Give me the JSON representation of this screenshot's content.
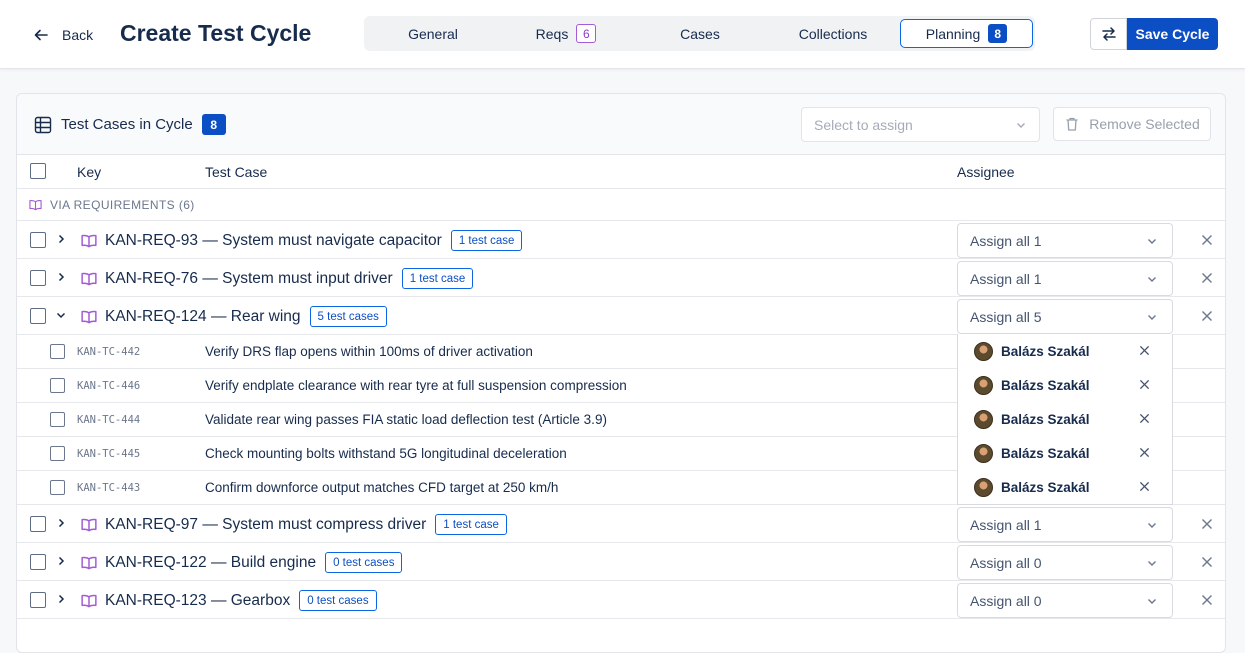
{
  "header": {
    "back_label": "Back",
    "title": "Create Test Cycle",
    "tabs": [
      {
        "label": "General",
        "badge": ""
      },
      {
        "label": "Reqs",
        "badge": "6"
      },
      {
        "label": "Cases",
        "badge": ""
      },
      {
        "label": "Collections",
        "badge": ""
      },
      {
        "label": "Planning",
        "badge": "8",
        "active": true
      }
    ],
    "save_label": "Save Cycle"
  },
  "panel": {
    "title": "Test Cases in Cycle",
    "count": "8",
    "select_placeholder": "Select to assign",
    "remove_label": "Remove Selected",
    "columns": {
      "key": "Key",
      "test_case": "Test Case",
      "assignee": "Assignee"
    },
    "group_label": "VIA REQUIREMENTS (6)",
    "requirements": [
      {
        "title": "KAN-REQ-93 — System must navigate capacitor",
        "badge": "1 test case",
        "assign": "Assign all 1",
        "expanded": false
      },
      {
        "title": "KAN-REQ-76 — System must input driver",
        "badge": "1 test case",
        "assign": "Assign all 1",
        "expanded": false
      },
      {
        "title": "KAN-REQ-124 — Rear wing",
        "badge": "5 test cases",
        "assign": "Assign all 5",
        "expanded": true
      },
      {
        "title": "KAN-REQ-97 — System must compress driver",
        "badge": "1 test case",
        "assign": "Assign all 1",
        "expanded": false
      },
      {
        "title": "KAN-REQ-122 — Build engine",
        "badge": "0 test cases",
        "assign": "Assign all 0",
        "expanded": false
      },
      {
        "title": "KAN-REQ-123 — Gearbox",
        "badge": "0 test cases",
        "assign": "Assign all 0",
        "expanded": false
      }
    ],
    "test_cases": [
      {
        "key": "KAN-TC-442",
        "name": "Verify DRS flap opens within 100ms of driver activation",
        "assignee": "Balázs Szakál"
      },
      {
        "key": "KAN-TC-446",
        "name": "Verify endplate clearance with rear tyre at full suspension compression",
        "assignee": "Balázs Szakál"
      },
      {
        "key": "KAN-TC-444",
        "name": "Validate rear wing passes FIA static load deflection test (Article 3.9)",
        "assignee": "Balázs Szakál"
      },
      {
        "key": "KAN-TC-445",
        "name": "Check mounting bolts withstand 5G longitudinal deceleration",
        "assignee": "Balázs Szakál"
      },
      {
        "key": "KAN-TC-443",
        "name": "Confirm downforce output matches CFD target at 250 km/h",
        "assignee": "Balázs Szakál"
      }
    ]
  },
  "colors": {
    "primary": "#0c4fc4",
    "requirement_icon": "#a35bd6",
    "border": "#e2e4e9"
  },
  "icons": {
    "back": "arrow-left-icon",
    "sync": "swap-arrows-icon",
    "table": "table-icon",
    "trash": "trash-icon",
    "requirement": "book-icon",
    "expand": "chevron-right-icon",
    "collapse": "chevron-down-icon",
    "remove": "close-icon"
  }
}
